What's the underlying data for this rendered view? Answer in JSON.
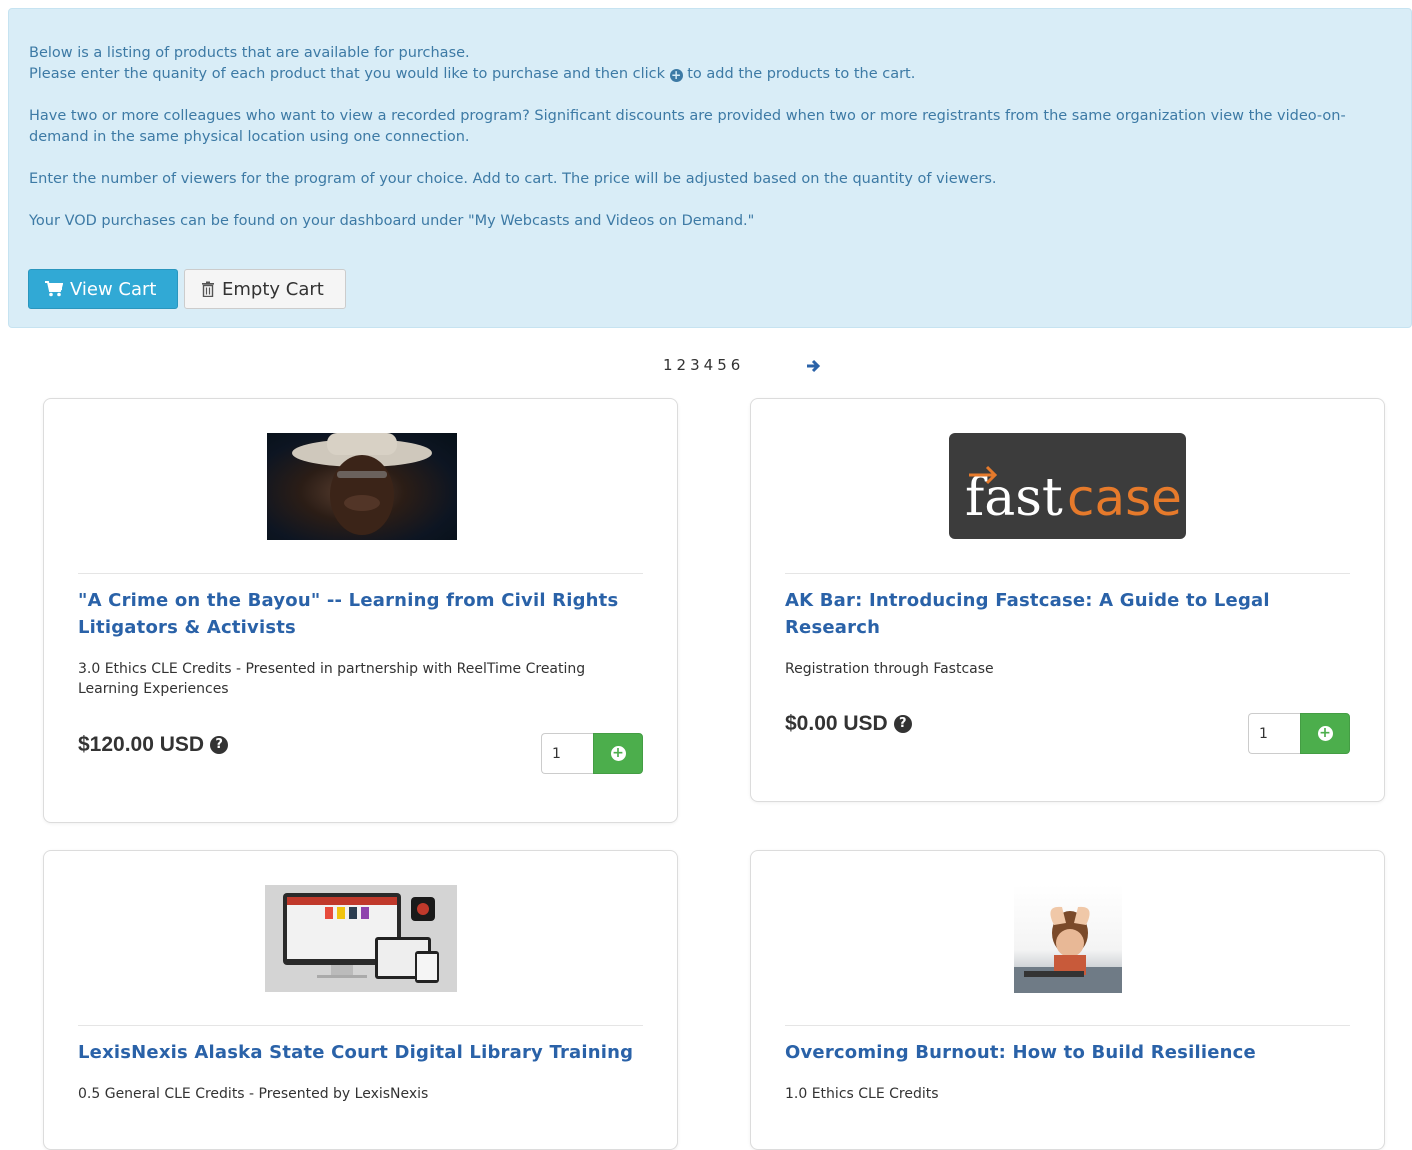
{
  "intro": {
    "line1": "Below is a listing of products that are available for purchase.",
    "line2_pre": "Please enter the quanity of each product that you would like to purchase and then click",
    "line2_post": "to add the products to the cart.",
    "para2": "Have two or more colleagues who want to view a recorded program? Significant discounts are provided when two or more registrants from the same organization view the video-on-demand in the same physical location using one connection.",
    "para3": "Enter the number of viewers for the program of your choice. Add to cart. The price will be adjusted based on the quantity of viewers.",
    "para4": "Your VOD purchases can be found on your dashboard under \"My Webcasts and Videos on Demand.\""
  },
  "buttons": {
    "view_cart": "View Cart",
    "empty_cart": "Empty Cart"
  },
  "pagination": {
    "pages": [
      "1",
      "2",
      "3",
      "4",
      "5",
      "6"
    ]
  },
  "products": [
    {
      "title": "\"A Crime on the Bayou\" -- Learning from Civil Rights Litigators & Activists",
      "description": "3.0 Ethics CLE Credits - Presented in partnership with ReelTime Creating Learning Experiences",
      "price": "$120.00 USD",
      "quantity": "1"
    },
    {
      "title": "AK Bar: Introducing Fastcase: A Guide to Legal Research",
      "description": "Registration through Fastcase",
      "price": "$0.00 USD",
      "quantity": "1",
      "logo_text_a": "fast",
      "logo_text_b": "case"
    },
    {
      "title": "LexisNexis Alaska State Court Digital Library Training",
      "description": "0.5 General CLE Credits - Presented by LexisNexis"
    },
    {
      "title": "Overcoming Burnout: How to Build Resilience",
      "description": "1.0 Ethics CLE Credits"
    }
  ],
  "colors": {
    "info_bg": "#d9edf7",
    "info_text": "#3d7aa5",
    "primary": "#31a9d5",
    "success": "#4cae4c",
    "link": "#2a62a8"
  }
}
